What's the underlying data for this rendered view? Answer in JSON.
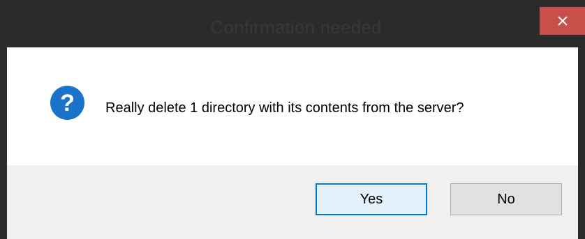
{
  "window": {
    "title": "Confirmation needed",
    "close_symbol": "×"
  },
  "dialog": {
    "icon": "question-icon",
    "message": "Really delete 1 directory with its contents from the server?"
  },
  "buttons": {
    "yes_label": "Yes",
    "no_label": "No"
  },
  "colors": {
    "titlebar": "#2b2b2b",
    "close_button": "#c7504a",
    "question_icon": "#1b73c9",
    "default_button_border": "#0078d7",
    "button_area": "#f0f0f0"
  }
}
